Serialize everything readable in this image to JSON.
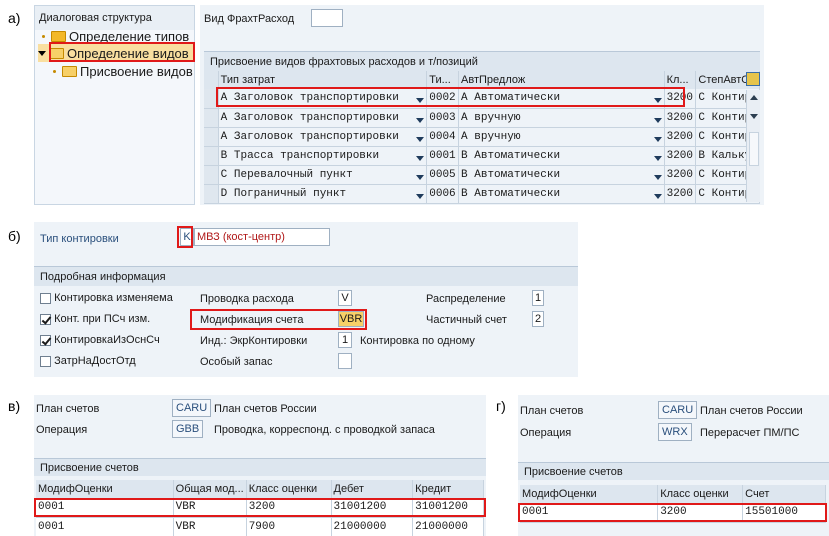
{
  "panels": {
    "a": "а)",
    "b": "б)",
    "v": "в)",
    "g": "г)"
  },
  "panelA": {
    "tree": {
      "header": "Диалоговая структура",
      "items": [
        "Определение типов",
        "Определение видов",
        "Присвоение видов"
      ]
    },
    "vid_label": "Вид ФрахтРасход",
    "vid_value": "",
    "section_title": "Присвоение видов фрахтовых расходов и т/позиций",
    "columns": [
      "Тип затрат",
      "Ти...",
      "АвтПредлож",
      "Кл...",
      "СтепАвтОб"
    ],
    "rows": [
      {
        "type": "A Заголовок транспортировки",
        "code": "0002",
        "auto": "A Автоматически",
        "cls": "3200",
        "step": "C Контир"
      },
      {
        "type": "A Заголовок транспортировки",
        "code": "0003",
        "auto": "A вручную",
        "cls": "3200",
        "step": "C Контир"
      },
      {
        "type": "A Заголовок транспортировки",
        "code": "0004",
        "auto": "A вручную",
        "cls": "3200",
        "step": "C Контир"
      },
      {
        "type": "B Трасса транспортировки",
        "code": "0001",
        "auto": "B Автоматически",
        "cls": "3200",
        "step": "B Кальку"
      },
      {
        "type": "C Перевалочный пункт",
        "code": "0005",
        "auto": "B Автоматически",
        "cls": "3200",
        "step": "C Контир"
      },
      {
        "type": "D Пограничный пункт",
        "code": "0006",
        "auto": "B Автоматически",
        "cls": "3200",
        "step": "C Контир"
      }
    ]
  },
  "panelB": {
    "tip_label": "Тип контировки",
    "tip_code": "K",
    "tip_text": "МВЗ (кост-центр)",
    "section_title": "Подробная информация",
    "cb": [
      {
        "label": "Контировка изменяема",
        "checked": false
      },
      {
        "label": "Конт. при ПСч изм.",
        "checked": true
      },
      {
        "label": "КонтировкаИзОснСч",
        "checked": true
      },
      {
        "label": "ЗатрНаДостОтд",
        "checked": false
      }
    ],
    "mid": [
      {
        "label": "Проводка расхода",
        "value": "V"
      },
      {
        "label": "Модификация счета",
        "value": "VBR"
      },
      {
        "label": "Инд.: ЭкрКонтировки",
        "value": "1"
      },
      {
        "label": "Особый запас",
        "value": ""
      }
    ],
    "right": [
      {
        "label": "Распределение",
        "value": "1"
      },
      {
        "label": "Частичный счет",
        "value": "2"
      }
    ],
    "kont_po_odnomu": "Контировка по одному"
  },
  "panelV": {
    "plan_label": "План счетов",
    "plan_code": "CARU",
    "plan_text": "План счетов России",
    "op_label": "Операция",
    "op_code": "GBB",
    "op_text": "Проводка, корреспонд. с проводкой запаса",
    "section_title": "Присвоение счетов",
    "columns": [
      "МодифОценки",
      "Общая мод...",
      "Класс оценки",
      "Дебет",
      "Кредит"
    ],
    "rows": [
      [
        "0001",
        "VBR",
        "3200",
        "31001200",
        "31001200"
      ],
      [
        "0001",
        "VBR",
        "7900",
        "21000000",
        "21000000"
      ]
    ]
  },
  "panelG": {
    "plan_label": "План счетов",
    "plan_code": "CARU",
    "plan_text": "План счетов России",
    "op_label": "Операция",
    "op_code": "WRX",
    "op_text": "Перерасчет ПМ/ПС",
    "section_title": "Присвоение счетов",
    "columns": [
      "МодифОценки",
      "Класс оценки",
      "Счет"
    ],
    "rows": [
      [
        "0001",
        "3200",
        "15501000"
      ]
    ]
  },
  "colors": {
    "highlight": "#e01919",
    "panel_bg": "#eef3f8",
    "header_bg": "#dde6ef",
    "link_blue": "#2a4f7c"
  }
}
